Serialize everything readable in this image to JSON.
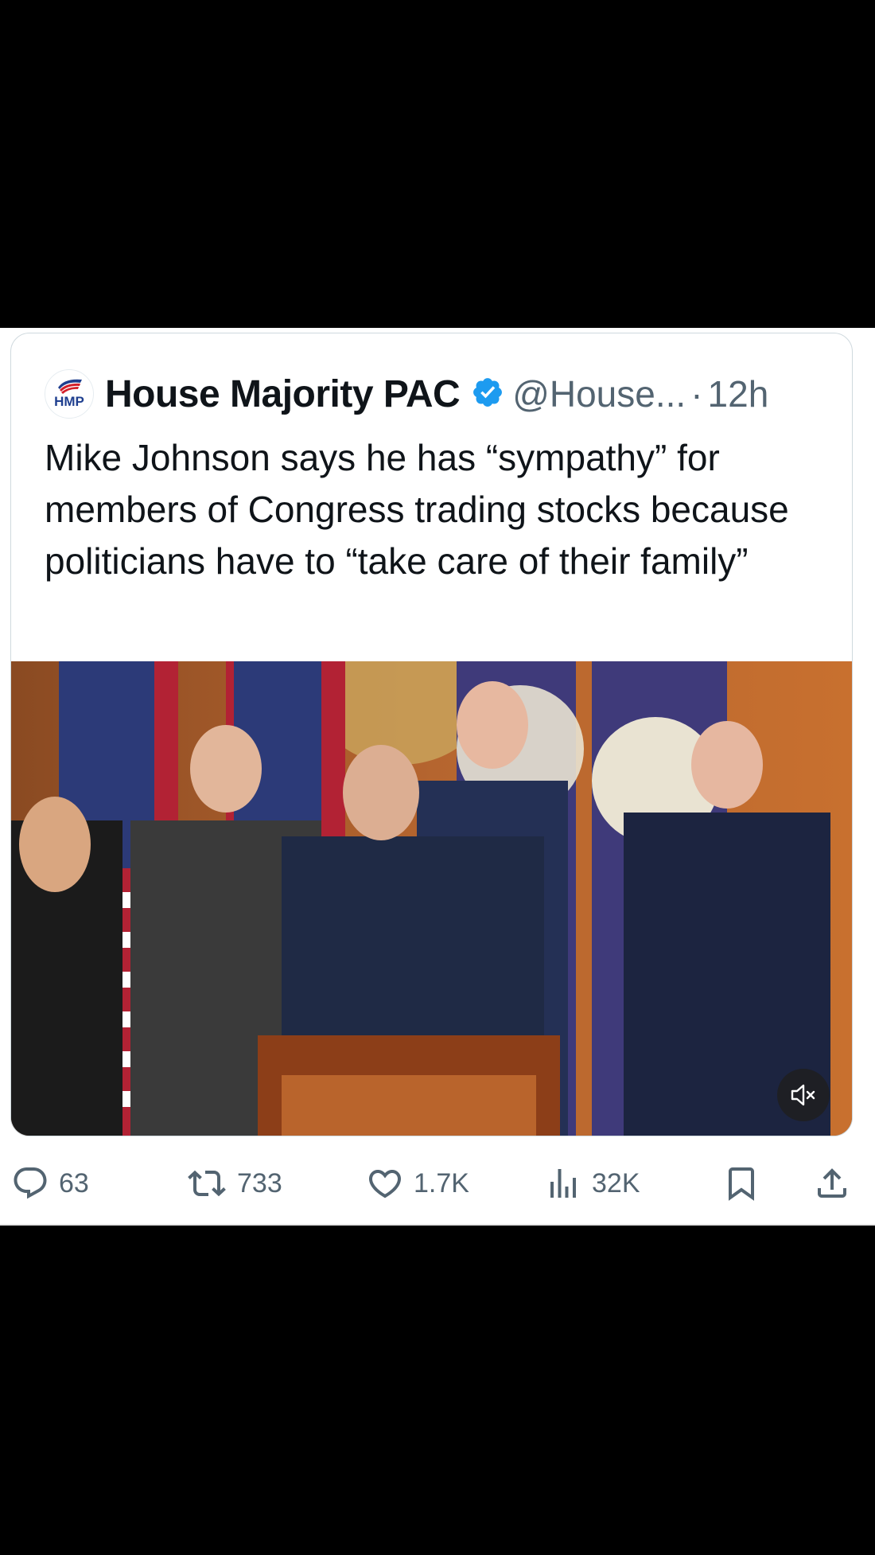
{
  "author": {
    "avatar_label": "HMP",
    "display_name": "House Majority PAC",
    "handle": "@House...",
    "separator": "·",
    "time": "12h"
  },
  "tweet": {
    "text": "Mike Johnson says he has “sympathy” for members of Congress trading stocks because politicians have to “take care of their family”"
  },
  "media": {
    "type": "video",
    "mute_icon": "speaker-muted-icon"
  },
  "actions": {
    "replies": "63",
    "reposts": "733",
    "likes": "1.7K",
    "views": "32K"
  },
  "colors": {
    "verified": "#1d9bf0",
    "text_primary": "#0f1419",
    "text_secondary": "#536471",
    "border": "#cfd9de"
  }
}
